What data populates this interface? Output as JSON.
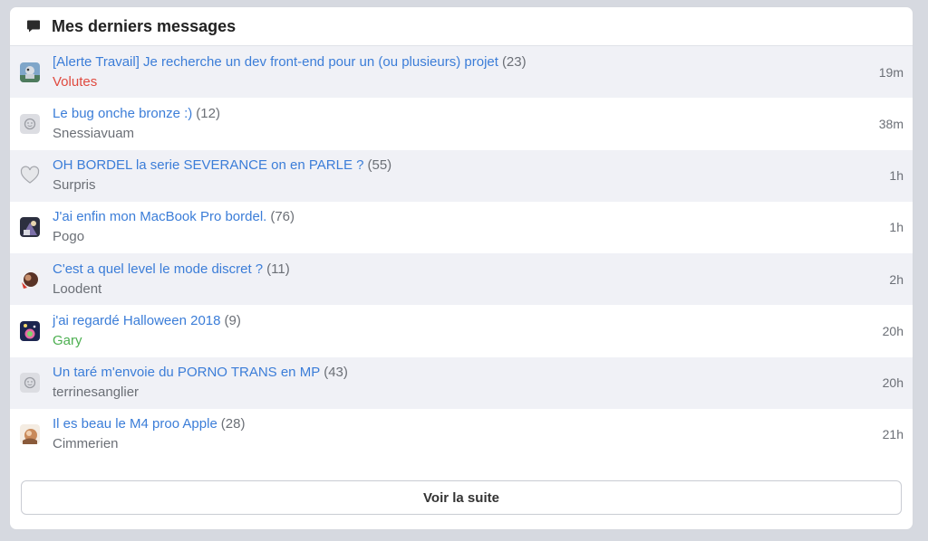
{
  "panel": {
    "title": "Mes derniers messages",
    "icon": "chat-bubble-icon"
  },
  "topics": [
    {
      "title": "[Alerte Travail] Je recherche un dev front-end pour un (ou plusieurs) projet",
      "count": "(23)",
      "author": "Volutes",
      "author_color": "#e04a3f",
      "time": "19m",
      "avatar": "avatar-image-icon"
    },
    {
      "title": "Le bug onche bronze :)",
      "count": "(12)",
      "author": "Snessiavuam",
      "time": "38m",
      "avatar": "default-avatar-icon"
    },
    {
      "title": "OH BORDEL la serie SEVERANCE on en PARLE ?",
      "count": "(55)",
      "author": "Surpris",
      "time": "1h",
      "avatar": "heart-icon"
    },
    {
      "title": "J'ai enfin mon MacBook Pro bordel.",
      "count": "(76)",
      "author": "Pogo",
      "time": "1h",
      "avatar": "avatar-image-icon"
    },
    {
      "title": "C'est a quel level le mode discret ?",
      "count": "(11)",
      "author": "Loodent",
      "time": "2h",
      "avatar": "avatar-image-icon"
    },
    {
      "title": "j'ai regardé Halloween 2018",
      "count": "(9)",
      "author": "Gary",
      "author_color": "#4caf50",
      "time": "20h",
      "avatar": "avatar-image-icon"
    },
    {
      "title": "Un taré m'envoie du PORNO TRANS en MP",
      "count": "(43)",
      "author": "terrinesanglier",
      "time": "20h",
      "avatar": "default-avatar-icon"
    },
    {
      "title": "Il es beau le M4 proo Apple",
      "count": "(28)",
      "author": "Cimmerien",
      "time": "21h",
      "avatar": "avatar-image-icon"
    }
  ],
  "more_button": "Voir la suite"
}
